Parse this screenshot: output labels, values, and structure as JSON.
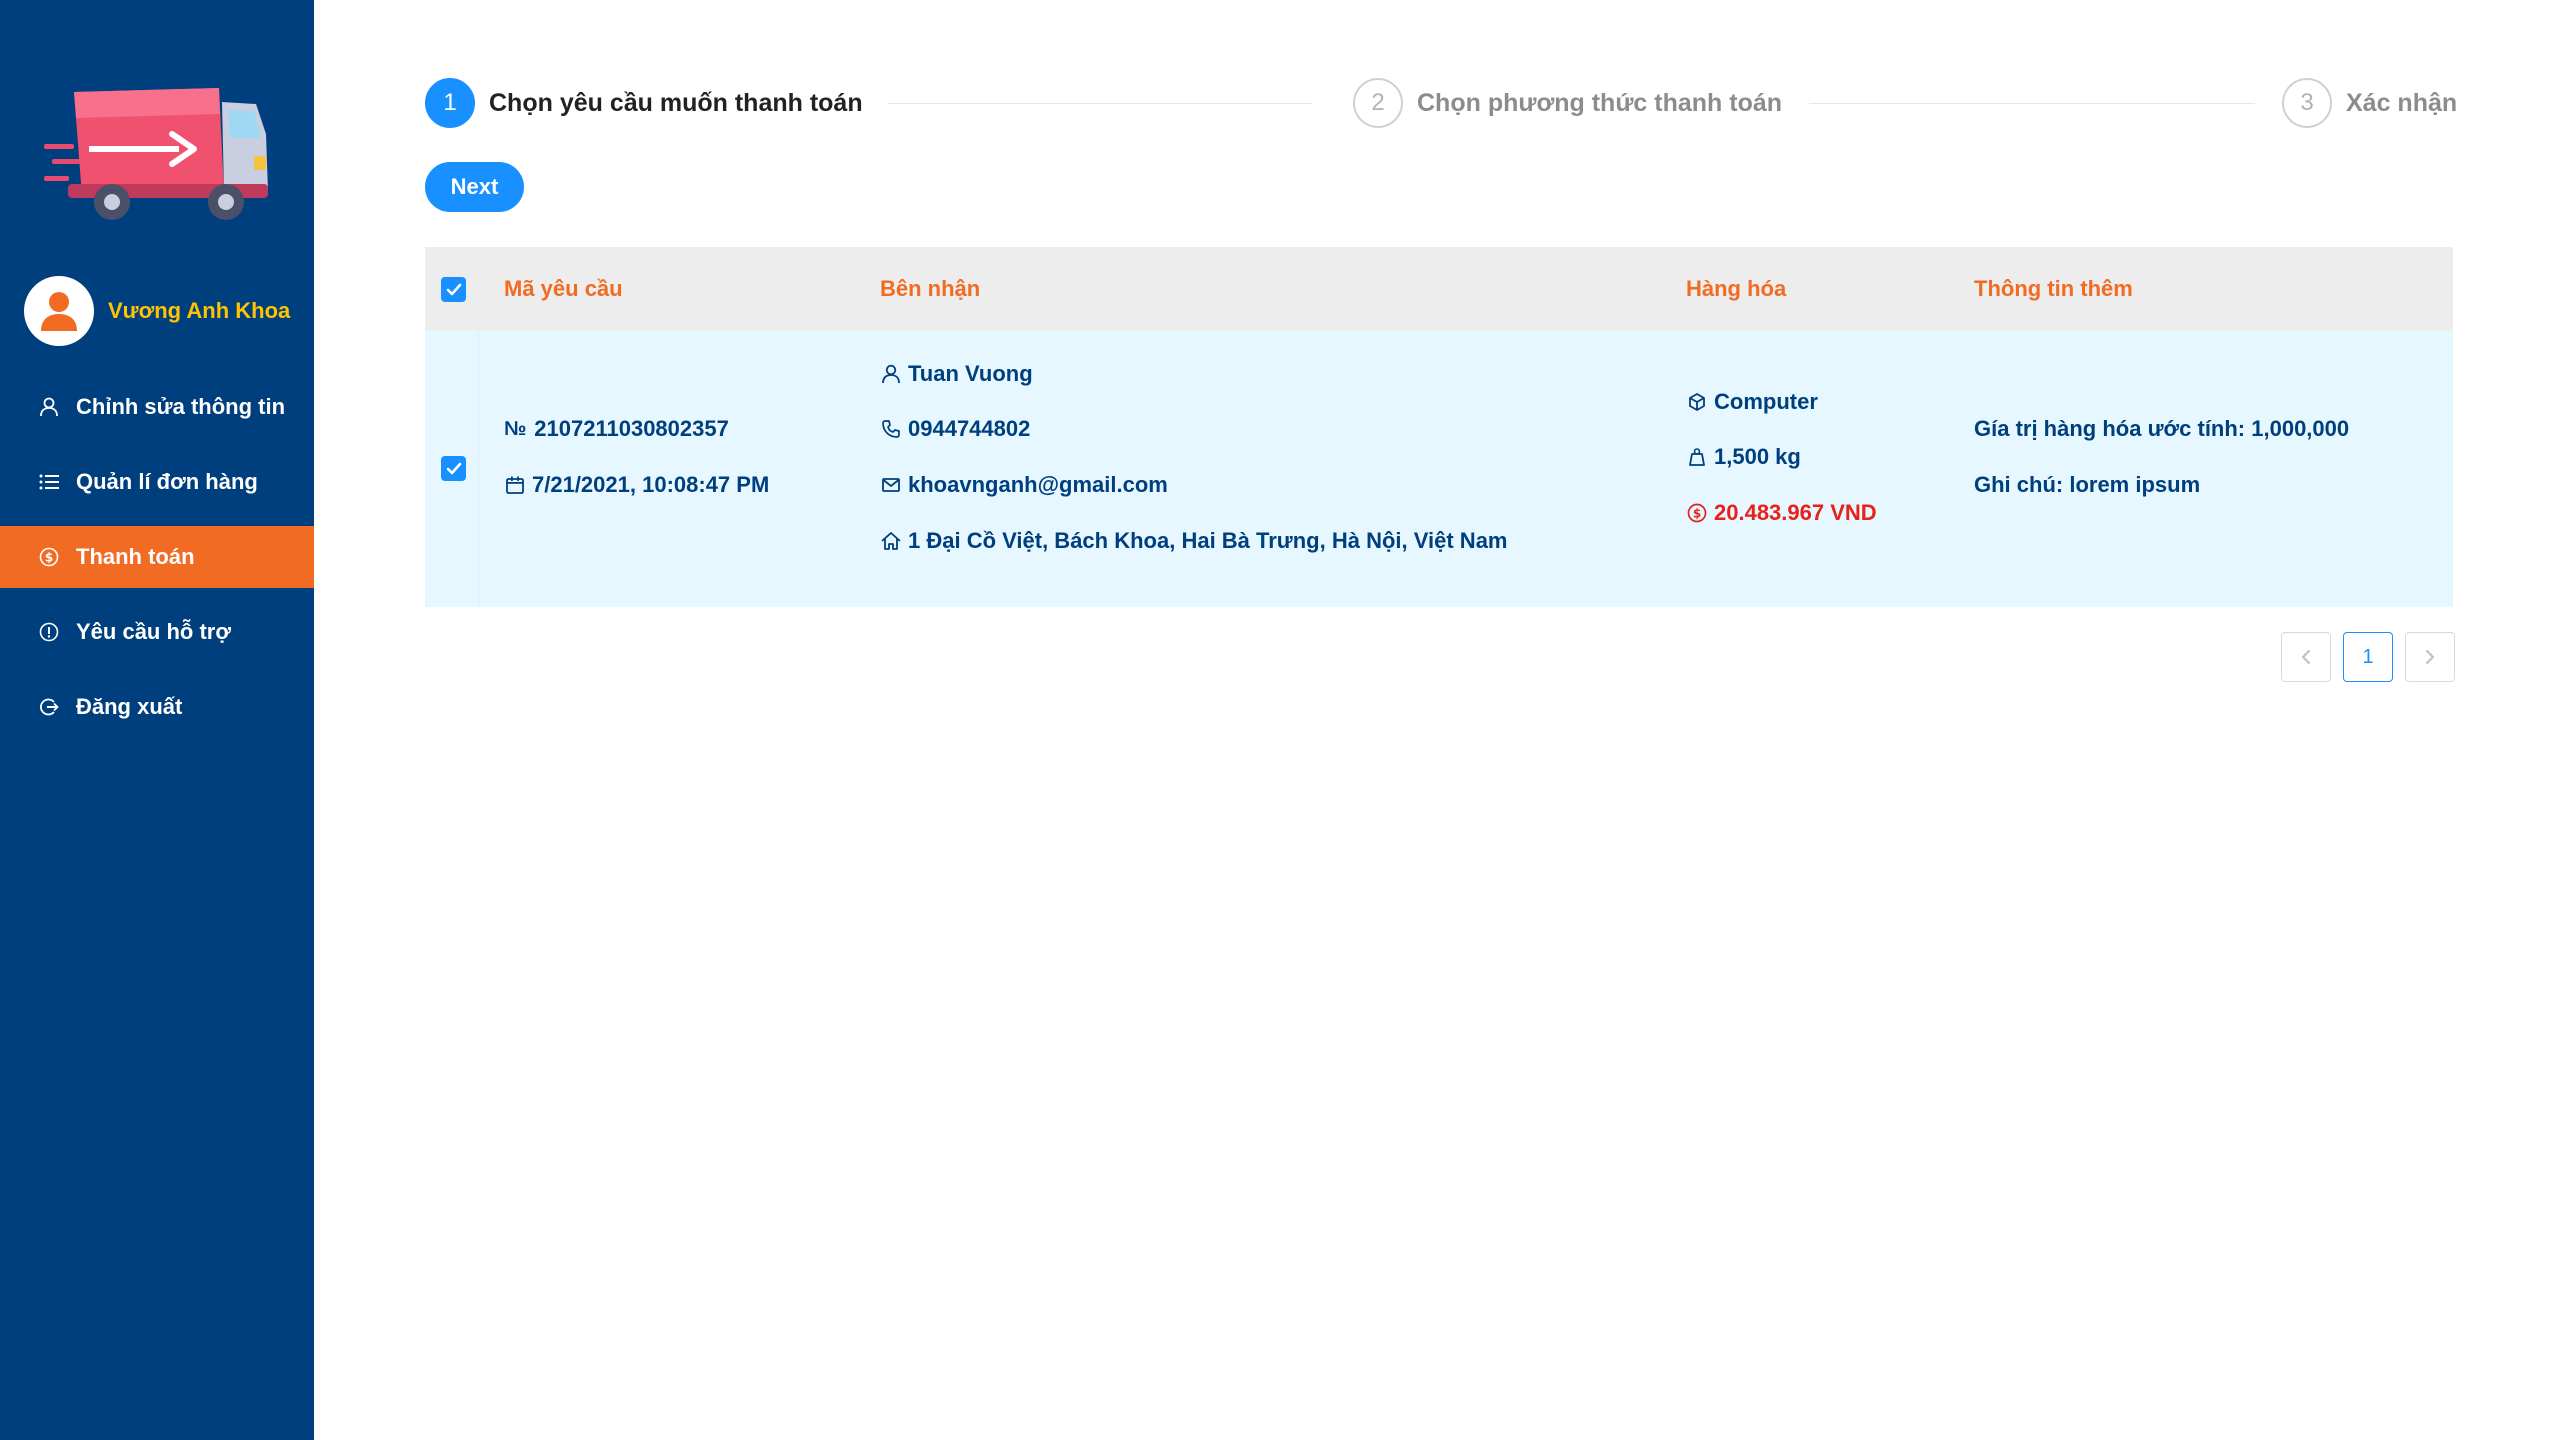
{
  "sidebar": {
    "user_name": "Vương Anh Khoa",
    "menu": [
      {
        "label": "Chỉnh sửa thông tin",
        "icon": "user-icon"
      },
      {
        "label": "Quản lí đơn hàng",
        "icon": "list-icon"
      },
      {
        "label": "Thanh toán",
        "icon": "dollar-icon",
        "active": true
      },
      {
        "label": "Yêu cầu hỗ trợ",
        "icon": "exclamation-icon"
      },
      {
        "label": "Đăng xuất",
        "icon": "logout-icon"
      }
    ]
  },
  "steps": [
    {
      "number": "1",
      "title": "Chọn yêu cầu muốn thanh toán",
      "active": true
    },
    {
      "number": "2",
      "title": "Chọn phương thức thanh toán",
      "active": false
    },
    {
      "number": "3",
      "title": "Xác nhận",
      "active": false
    }
  ],
  "next_label": "Next",
  "table": {
    "headers": {
      "code": "Mã yêu cầu",
      "receiver": "Bên nhận",
      "goods": "Hàng hóa",
      "extra": "Thông tin thêm"
    },
    "rows": [
      {
        "checked": true,
        "code_prefix": "№",
        "code": "2107211030802357",
        "date": "7/21/2021, 10:08:47 PM",
        "receiver_name": "Tuan Vuong",
        "receiver_phone": "0944744802",
        "receiver_email": "khoavnganh@gmail.com",
        "receiver_address": "1 Đại Cồ Việt, Bách Khoa, Hai Bà Trưng, Hà Nội, Việt Nam",
        "goods_name": "Computer",
        "goods_weight": "1,500 kg",
        "goods_price": "20.483.967 VND",
        "extra_value": "Gía trị hàng hóa ước tính: 1,000,000",
        "extra_note": "Ghi chú: lorem ipsum"
      }
    ]
  },
  "pagination": {
    "prev": "‹",
    "current": "1",
    "next": "›"
  },
  "colors": {
    "sidebar_bg": "#003f7d",
    "accent_orange": "#f26b22",
    "primary_blue": "#1890ff",
    "user_name_yellow": "#ffc300",
    "price_red": "#e8201a"
  }
}
